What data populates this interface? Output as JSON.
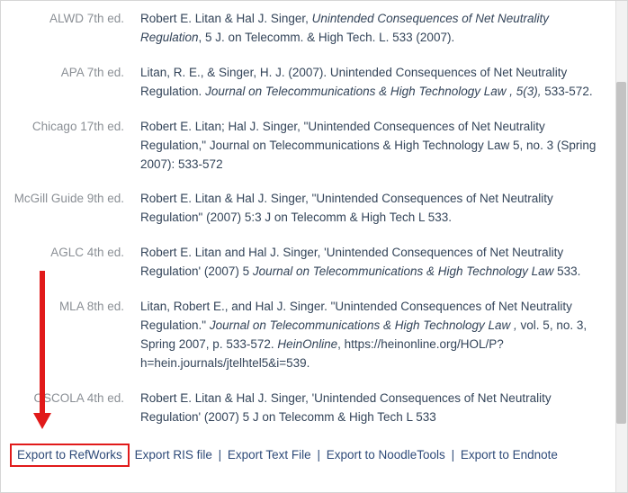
{
  "citations": [
    {
      "style": "ALWD 7th ed.",
      "segments": [
        {
          "text": "Robert E. Litan & Hal J. Singer, "
        },
        {
          "text": "Unintended Consequences of Net Neutrality Regulation",
          "ital": true
        },
        {
          "text": ", 5 J. on Telecomm. & High Tech. L. 533 (2007)."
        }
      ]
    },
    {
      "style": "APA 7th ed.",
      "segments": [
        {
          "text": "Litan, R. E., & Singer, H. J. (2007). Unintended Consequences of Net Neutrality Regulation. "
        },
        {
          "text": "Journal on Telecommunications & High Technology Law , 5(3),",
          "ital": true
        },
        {
          "text": " 533-572."
        }
      ]
    },
    {
      "style": "Chicago 17th ed.",
      "segments": [
        {
          "text": "Robert E. Litan; Hal J. Singer, \"Unintended Consequences of Net Neutrality Regulation,\" Journal on Telecommunications & High Technology Law 5, no. 3 (Spring 2007): 533-572"
        }
      ]
    },
    {
      "style": "McGill Guide 9th ed.",
      "segments": [
        {
          "text": "Robert E. Litan & Hal J. Singer, \"Unintended Consequences of Net Neutrality Regulation\" (2007) 5:3 J on Telecomm & High Tech L 533."
        }
      ]
    },
    {
      "style": "AGLC 4th ed.",
      "segments": [
        {
          "text": "Robert E. Litan and Hal J. Singer, 'Unintended Consequences of Net Neutrality Regulation' (2007) 5 "
        },
        {
          "text": "Journal on Telecommunications & High Technology Law",
          "ital": true
        },
        {
          "text": " 533."
        }
      ]
    },
    {
      "style": "MLA 8th ed.",
      "segments": [
        {
          "text": "Litan, Robert E., and Hal J. Singer. \"Unintended Consequences of Net Neutrality Regulation.\" "
        },
        {
          "text": "Journal on Telecommunications & High Technology Law ,",
          "ital": true
        },
        {
          "text": " vol. 5, no. 3, Spring 2007, p. 533-572. "
        },
        {
          "text": "HeinOnline",
          "ital": true
        },
        {
          "text": ", https://heinonline.org/HOL/P?h=hein.journals/jtelhtel5&i=539."
        }
      ]
    },
    {
      "style": "OSCOLA 4th ed.",
      "segments": [
        {
          "text": "Robert E. Litan & Hal J. Singer, 'Unintended Consequences of Net Neutrality Regulation' (2007) 5 J on Telecomm & High Tech L 533"
        }
      ]
    }
  ],
  "export": {
    "refworks": "Export to RefWorks",
    "ris": "Export RIS file",
    "text": "Export Text File",
    "noodle": "Export to NoodleTools",
    "endnote": "Export to Endnote"
  }
}
